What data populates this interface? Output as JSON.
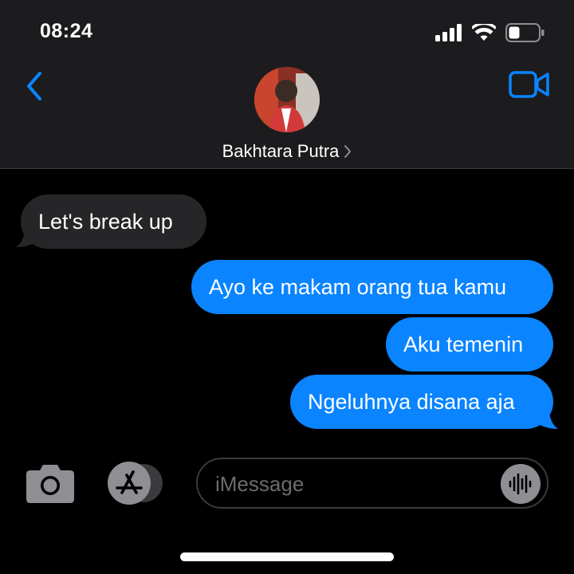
{
  "status_bar": {
    "time": "08:24"
  },
  "header": {
    "contact_name": "Bakhtara Putra"
  },
  "messages": [
    {
      "direction": "incoming",
      "text": "Let's break up"
    },
    {
      "direction": "outgoing",
      "text": "Ayo ke makam orang tua kamu"
    },
    {
      "direction": "outgoing",
      "text": "Aku temenin"
    },
    {
      "direction": "outgoing",
      "text": "Ngeluhnya disana aja"
    }
  ],
  "composer": {
    "placeholder": "iMessage",
    "value": ""
  },
  "icons": {
    "back": "chevron-left-icon",
    "video": "video-camera-icon",
    "camera": "camera-icon",
    "appstore": "app-store-icon",
    "audio": "waveform-icon"
  },
  "colors": {
    "accent": "#0a84ff",
    "incoming_bubble": "#262628",
    "header_bg": "#1c1c1e"
  }
}
